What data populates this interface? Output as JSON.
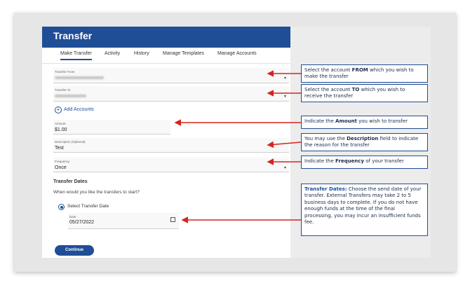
{
  "app": {
    "title": "Transfer",
    "tabs": [
      "Make Transfer",
      "Activity",
      "History",
      "Manage Templates",
      "Manage Accounts"
    ]
  },
  "form": {
    "transfer_from_label": "Transfer From",
    "transfer_to_label": "Transfer To",
    "add_accounts": "Add Accounts",
    "amount_label": "Amount",
    "amount_value": "$1.00",
    "description_label": "Description (Optional)",
    "description_value": "Test",
    "frequency_label": "Frequency",
    "frequency_value": "Once",
    "transfer_dates_title": "Transfer Dates",
    "transfer_dates_question": "When would you like the transfers to start?",
    "radio_label": "Select Transfer Date",
    "date_label": "Date",
    "date_value": "05/27/2022",
    "continue_label": "Continue"
  },
  "callouts": {
    "c1": {
      "pre": "Select the account ",
      "key": "FROM",
      "post": " which you wish to make the transfer"
    },
    "c2": {
      "pre": "Select the account ",
      "key": "TO",
      "post": " which you wish to receive the transfer"
    },
    "c3": {
      "pre": "Indicate the ",
      "key": "Amount",
      "post": " you wish to transfer"
    },
    "c4": {
      "pre": "You may use the ",
      "key": "Description",
      "post": " field to indicate the reason for the transfer"
    },
    "c5": {
      "pre": "Indicate the ",
      "key": "Frequency",
      "post": " of your transfer"
    },
    "c6": {
      "key": "Transfer Dates:",
      "post": " Choose the send date of your transfer. External Transfers may take 2 to 5 business days to complete. If you do not have enough funds at the time of the final processing, you may incur an insufficient funds fee."
    }
  },
  "colors": {
    "primary": "#1f4e96",
    "arrow": "#d9231f"
  }
}
